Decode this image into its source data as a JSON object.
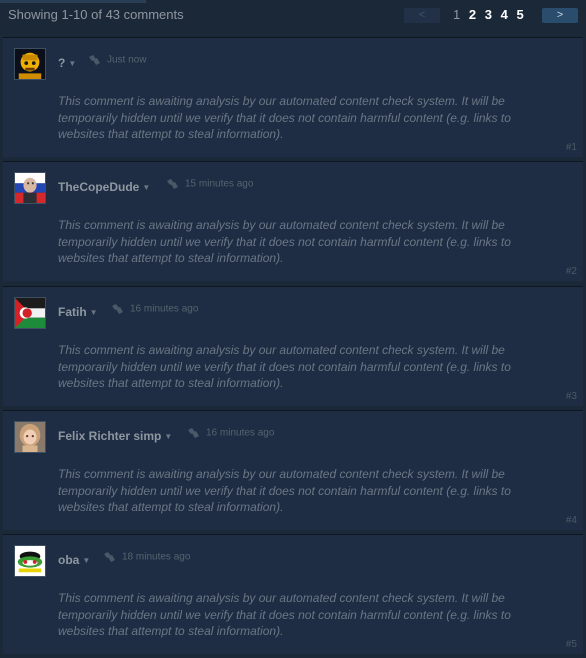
{
  "header": {
    "showing": "Showing 1-10 of 43 comments",
    "prev": "<",
    "next": ">",
    "pages": [
      "1",
      "2",
      "3",
      "4",
      "5"
    ]
  },
  "comments": [
    {
      "author": "?",
      "time": "Just now",
      "text": "This comment is awaiting analysis by our automated content check system. It will be temporarily hidden until we verify that it does not contain harmful content (e.g. links to websites that attempt to steal information).",
      "index": "#1"
    },
    {
      "author": "TheCopeDude",
      "time": "15 minutes ago",
      "text": "This comment is awaiting analysis by our automated content check system. It will be temporarily hidden until we verify that it does not contain harmful content (e.g. links to websites that attempt to steal information).",
      "index": "#2"
    },
    {
      "author": "Fatih",
      "time": "16 minutes ago",
      "text": "This comment is awaiting analysis by our automated content check system. It will be temporarily hidden until we verify that it does not contain harmful content (e.g. links to websites that attempt to steal information).",
      "index": "#3"
    },
    {
      "author": "Felix Richter simp",
      "time": "16 minutes ago",
      "text": "This comment is awaiting analysis by our automated content check system. It will be temporarily hidden until we verify that it does not contain harmful content (e.g. links to websites that attempt to steal information).",
      "index": "#4"
    },
    {
      "author": "oba",
      "time": "18 minutes ago",
      "text": "This comment is awaiting analysis by our automated content check system. It will be temporarily hidden until we verify that it does not contain harmful content (e.g. links to websites that attempt to steal information).",
      "index": "#5"
    }
  ],
  "colors": {
    "background": "#1b2838",
    "comment_bg": "#1e2d44",
    "text_muted": "#8f98a0"
  }
}
